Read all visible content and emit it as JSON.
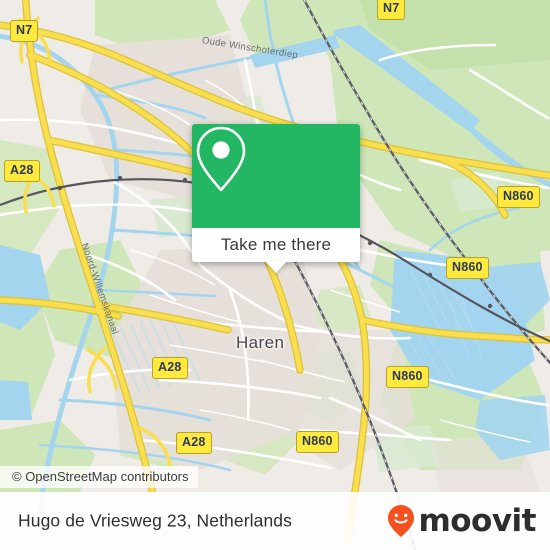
{
  "map": {
    "provider_attribution": "© OpenStreetMap contributors",
    "place_labels": [
      {
        "name": "Haren"
      }
    ],
    "water_labels": [
      {
        "name": "Oude Winschoterdiep"
      },
      {
        "name": "Noord-Willemskanaal"
      }
    ],
    "road_shields": [
      {
        "ref": "N7"
      },
      {
        "ref": "N7"
      },
      {
        "ref": "A28"
      },
      {
        "ref": "A28"
      },
      {
        "ref": "A28"
      },
      {
        "ref": "N860"
      },
      {
        "ref": "N860"
      },
      {
        "ref": "N860"
      },
      {
        "ref": "N860"
      }
    ],
    "colors": {
      "land": "#efebe6",
      "green": "#cde5b6",
      "water": "#a5d6f0",
      "road_major": "#f8d94a",
      "road_minor": "#ffffff",
      "rail": "#55555c",
      "shield_fill": "#ffe93c",
      "shield_text": "#2b3a5c"
    }
  },
  "card": {
    "cta_label": "Take me there",
    "pin_icon": "map-pin-icon",
    "accent_color": "#23b763"
  },
  "footer": {
    "address": "Hugo de Vriesweg 23, Netherlands",
    "brand_name": "moovit",
    "brand_icon": "moovit-pin-smiley-icon",
    "brand_color": "#ff5722"
  }
}
